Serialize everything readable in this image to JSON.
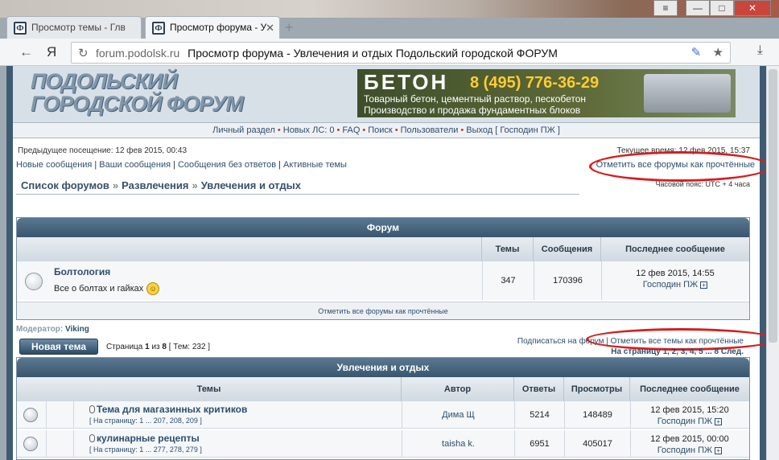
{
  "browser": {
    "tabs": [
      {
        "label": "Просмотр темы - Глв"
      },
      {
        "label": "Просмотр форума - У"
      }
    ],
    "new_tab_symbol": "+",
    "back_symbol": "←",
    "yandex_symbol": "Я",
    "refresh_symbol": "↻",
    "url_host": "forum.podolsk.ru",
    "url_title": "Просмотр форума - Увлечения и отдых Подольский городской ФОРУМ",
    "window_controls": [
      "—",
      "□",
      "✕"
    ],
    "menu_symbol": "≡"
  },
  "header": {
    "logo_line1": "ПОДОЛЬСКИЙ",
    "logo_line2": "ГОРОДСКОЙ ФОРУМ",
    "banner_title": "БЕТОН",
    "banner_phone": "8 (495) 776-36-29",
    "banner_line1": "Товарный бетон, цементный раствор, пескобетон",
    "banner_line2": "Производство и продажа фундаментных блоков"
  },
  "navbar": {
    "items": [
      "Личный раздел",
      "Новых ЛС: 0",
      "FAQ",
      "Поиск",
      "Пользователи",
      "Выход [ Господин ПЖ ]"
    ]
  },
  "info": {
    "previous_visit": "Предыдущее посещение: 12 фев 2015, 00:43",
    "current_time": "Текущее время: 12 фев 2015, 15:37",
    "links": [
      "Новые сообщения",
      "Ваши сообщения",
      "Сообщения без ответов",
      "Активные темы"
    ],
    "mark_all_forums": "Отметить все форумы как прочтённые",
    "timezone": "Часовой пояс: UTC + 4 часа"
  },
  "breadcrumb": [
    "Список форумов",
    "Развлечения",
    "Увлечения и отдых"
  ],
  "forum_table": {
    "caption": "Форум",
    "columns": [
      "Темы",
      "Сообщения",
      "Последнее сообщение"
    ],
    "row": {
      "name": "Болтология",
      "description": "Все о болтах и гайках",
      "topics": "347",
      "posts": "170396",
      "last_date": "12 фев 2015, 14:55",
      "last_author": "Господин ПЖ"
    },
    "mark_read": "Отметить все форумы как прочтённые"
  },
  "moderator": {
    "label": "Модератор:",
    "name": "Viking"
  },
  "new_topic_button": "Новая тема",
  "pageinfo": {
    "text": "Страница",
    "current": "1",
    "of": "из",
    "total": "8",
    "topics": "[ Тем: 232 ]"
  },
  "subscribe": {
    "prefix": "Подписаться на форум",
    "mark_topics": "Отметить все темы как прочтённые"
  },
  "pagination": "На страницу 1, 2, 3, 4, 5 ... 8 След.",
  "topics_table": {
    "caption": "Увлечения и отдых",
    "columns": [
      "Темы",
      "Автор",
      "Ответы",
      "Просмотры",
      "Последнее сообщение"
    ],
    "rows": [
      {
        "title": "Тема для магазинных критиков",
        "pages": "[ На страницу: 1 ... 207, 208, 209 ]",
        "author": "Дима Щ",
        "replies": "5214",
        "views": "148489",
        "last_date": "12 фев 2015, 15:20",
        "last_author": "Господин ПЖ"
      },
      {
        "title": "кулинарные рецепты",
        "pages": "[ На страницу: 1 ... 277, 278, 279 ]",
        "author": "taisha k.",
        "replies": "6951",
        "views": "405017",
        "last_date": "12 фев 2015, 00:00",
        "last_author": "Господин ПЖ"
      }
    ]
  },
  "icons": [
    "forum-logo-icon",
    "close-icon",
    "back-arrow-icon",
    "refresh-icon",
    "feather-icon",
    "star-icon",
    "download-icon",
    "forum-read-icon",
    "smiley-icon",
    "view-latest-icon",
    "attachment-icon"
  ],
  "colors": {
    "frame": "#3e5b74",
    "header_band": "#5a7892",
    "link": "#2e4e6e",
    "highlight_oval": "#d42020"
  }
}
